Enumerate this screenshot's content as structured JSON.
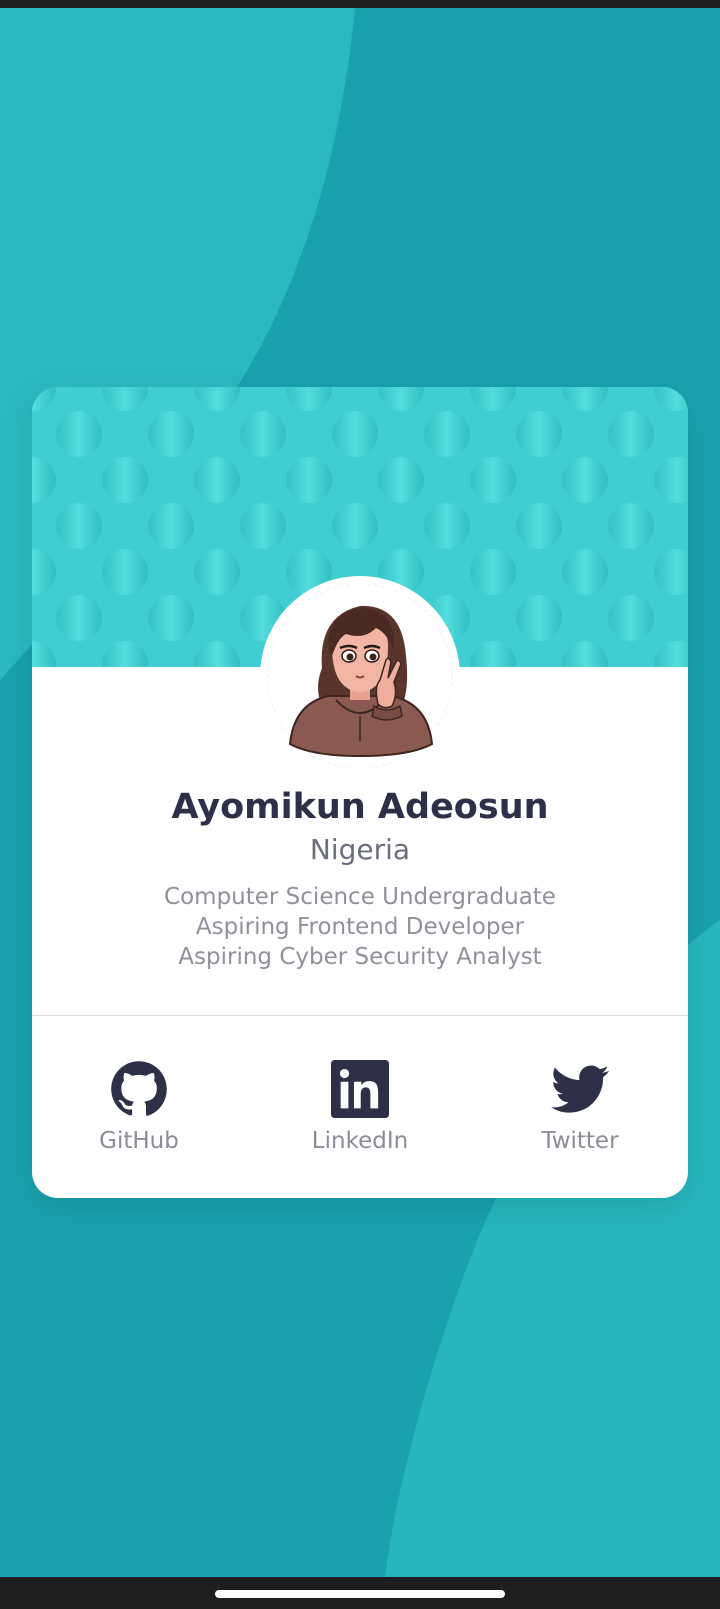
{
  "profile": {
    "name": "Ayomikun Adeosun",
    "country": "Nigeria",
    "bio": [
      "Computer Science Undergraduate",
      "Aspiring Frontend Developer",
      "Aspiring Cyber Security Analyst"
    ],
    "avatar_icon": "avatar-illustration"
  },
  "social_links": [
    {
      "label": "GitHub",
      "icon": "github-icon"
    },
    {
      "label": "LinkedIn",
      "icon": "linkedin-icon"
    },
    {
      "label": "Twitter",
      "icon": "twitter-icon"
    }
  ],
  "colors": {
    "background": "#19a1ae",
    "background_accent": "#26b8be",
    "card_header": "#3fcfd2",
    "card": "#ffffff",
    "heading_text": "#2d3047",
    "secondary_text": "#6b6f7d",
    "muted_text": "#8f929b",
    "icon_color": "#2d3047"
  }
}
